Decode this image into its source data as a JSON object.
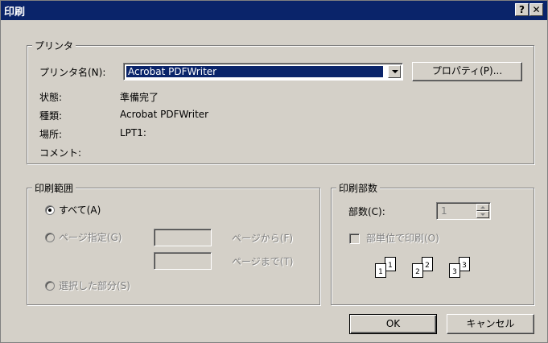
{
  "window": {
    "title": "印刷",
    "help_button": "?",
    "close_button": "✕"
  },
  "printer": {
    "group_label": "プリンタ",
    "name_label": "プリンタ名(N):",
    "selected": "Acrobat PDFWriter",
    "properties_button": "プロパティ(P)...",
    "status_label": "状態:",
    "status_value": "準備完了",
    "type_label": "種類:",
    "type_value": "Acrobat PDFWriter",
    "where_label": "場所:",
    "where_value": "LPT1:",
    "comment_label": "コメント:",
    "comment_value": ""
  },
  "range": {
    "group_label": "印刷範囲",
    "all_label": "すべて(A)",
    "pages_label": "ページ指定(G)",
    "from_label": "ページから(F)",
    "to_label": "ページまで(T)",
    "from_value": "",
    "to_value": "",
    "selection_label": "選択した部分(S)"
  },
  "copies": {
    "group_label": "印刷部数",
    "count_label": "部数(C):",
    "count_value": "1",
    "collate_label": "部単位で印刷(O)",
    "collate_icon": {
      "groups": [
        [
          "1",
          "1"
        ],
        [
          "2",
          "2"
        ],
        [
          "3",
          "3"
        ]
      ]
    }
  },
  "buttons": {
    "ok": "OK",
    "cancel": "キャンセル"
  }
}
